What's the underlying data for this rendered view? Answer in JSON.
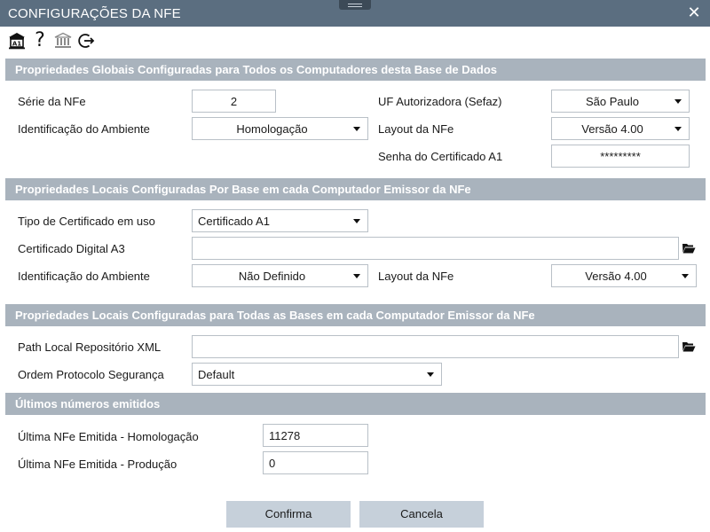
{
  "window": {
    "title": "CONFIGURAÇÕES DA NFE",
    "close": "✕"
  },
  "toolbar": {
    "icons": [
      "bank-a1-icon",
      "help-icon",
      "bank-icon",
      "logout-icon"
    ],
    "help_glyph": "?"
  },
  "global": {
    "title": "Propriedades Globais Configuradas para Todos os Computadores desta Base de Dados",
    "serie_label": "Série da NFe",
    "serie_value": "2",
    "ambiente_label": "Identificação do Ambiente",
    "ambiente_value": "Homologação",
    "uf_label": "UF Autorizadora (Sefaz)",
    "uf_value": "São Paulo",
    "layout_label": "Layout da NFe",
    "layout_value": "Versão 4.00",
    "senha_label": "Senha do Certificado A1",
    "senha_value": "*********"
  },
  "local_base": {
    "title": "Propriedades Locais Configuradas Por Base em cada Computador Emissor da NFe",
    "tipo_cert_label": "Tipo de Certificado em uso",
    "tipo_cert_value": "Certificado A1",
    "cert_a3_label": "Certificado Digital A3",
    "cert_a3_value": "",
    "ambiente_label": "Identificação do Ambiente",
    "ambiente_value": "Não Definido",
    "layout_label": "Layout da NFe",
    "layout_value": "Versão 4.00"
  },
  "local_all": {
    "title": "Propriedades Locais Configuradas para Todas as Bases em cada Computador Emissor da NFe",
    "path_label": "Path Local Repositório XML",
    "path_value": "",
    "ordem_label": "Ordem Protocolo Segurança",
    "ordem_value": "Default"
  },
  "ultimos": {
    "title": "Últimos números emitidos",
    "homolog_label": "Última NFe Emitida - Homologação",
    "homolog_value": "11278",
    "producao_label": "Última NFe Emitida - Produção",
    "producao_value": "0"
  },
  "buttons": {
    "confirm": "Confirma",
    "cancel": "Cancela"
  },
  "colors": {
    "titlebar": "#5b6e80",
    "section": "#a9b3bd",
    "button": "#c6d0da"
  }
}
